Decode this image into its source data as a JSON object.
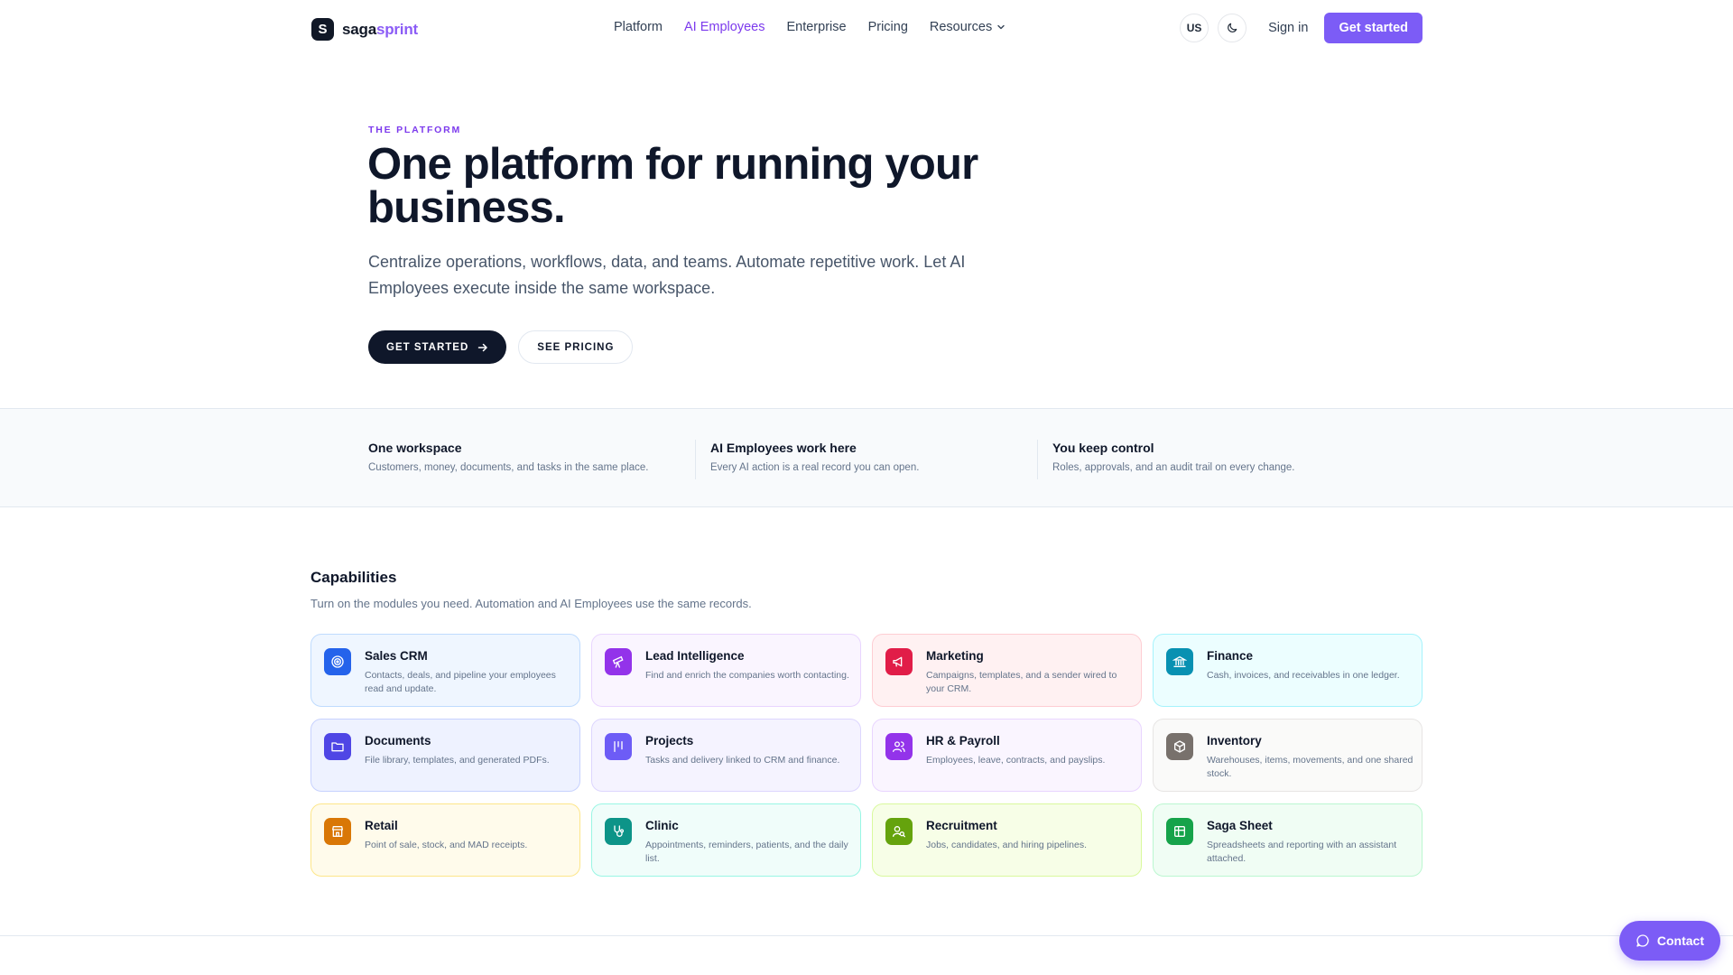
{
  "nav": {
    "logo_mark": "S",
    "logo_left": "saga",
    "logo_right": "sprint",
    "links": [
      "Platform",
      "AI Employees",
      "Enterprise",
      "Pricing",
      "Resources"
    ],
    "locale": "US",
    "sign_in": "Sign in",
    "get_started": "Get started"
  },
  "hero": {
    "eyebrow": "THE PLATFORM",
    "title": "One platform for running your business.",
    "subtitle": "Centralize operations, workflows, data, and teams. Automate repetitive work. Let AI Employees execute inside the same workspace.",
    "primary_button": "GET STARTED",
    "secondary_button": "SEE PRICING"
  },
  "features": [
    {
      "title": "One workspace",
      "desc": "Customers, money, documents, and tasks in the same place."
    },
    {
      "title": "AI Employees work here",
      "desc": "Every AI action is a real record you can open."
    },
    {
      "title": "You keep control",
      "desc": "Roles, approvals, and an audit trail on every change."
    }
  ],
  "capabilities": {
    "title": "Capabilities",
    "subtitle": "Turn on the modules you need. Automation and AI Employees use the same records.",
    "cards": [
      {
        "title": "Sales CRM",
        "desc": "Contacts, deals, and pipeline your employees read and update.",
        "icon": "target-icon",
        "color": "#2563eb",
        "bg": "#eff6ff",
        "border": "#bfdbfe"
      },
      {
        "title": "Lead Intelligence",
        "desc": "Find and enrich the companies worth contacting.",
        "icon": "telescope-icon",
        "color": "#9333ea",
        "bg": "#faf5ff",
        "border": "#e9d5ff"
      },
      {
        "title": "Marketing",
        "desc": "Campaigns, templates, and a sender wired to your CRM.",
        "icon": "megaphone-icon",
        "color": "#e11d48",
        "bg": "#fff1f2",
        "border": "#fecdd3"
      },
      {
        "title": "Finance",
        "desc": "Cash, invoices, and receivables in one ledger.",
        "icon": "bank-icon",
        "color": "#0891b2",
        "bg": "#ecfeff",
        "border": "#a5f3fc"
      },
      {
        "title": "Documents",
        "desc": "File library, templates, and generated PDFs.",
        "icon": "folder-icon",
        "color": "#4f46e5",
        "bg": "#eef2ff",
        "border": "#c7d2fe"
      },
      {
        "title": "Projects",
        "desc": "Tasks and delivery linked to CRM and finance.",
        "icon": "kanban-icon",
        "color": "#6d5cf6",
        "bg": "#f5f3ff",
        "border": "#ddd6fe"
      },
      {
        "title": "HR & Payroll",
        "desc": "Employees, leave, contracts, and payslips.",
        "icon": "users-icon",
        "color": "#9333ea",
        "bg": "#faf5ff",
        "border": "#e9d5ff"
      },
      {
        "title": "Inventory",
        "desc": "Warehouses, items, movements, and one shared stock.",
        "icon": "box-icon",
        "color": "#78716c",
        "bg": "#fafaf9",
        "border": "#e7e5e4"
      },
      {
        "title": "Retail",
        "desc": "Point of sale, stock, and MAD receipts.",
        "icon": "store-icon",
        "color": "#d97706",
        "bg": "#fffbeb",
        "border": "#fde68a"
      },
      {
        "title": "Clinic",
        "desc": "Appointments, reminders, patients, and the daily list.",
        "icon": "stethoscope-icon",
        "color": "#0d9488",
        "bg": "#f0fdfa",
        "border": "#99f6e4"
      },
      {
        "title": "Recruitment",
        "desc": "Jobs, candidates, and hiring pipelines.",
        "icon": "user-search-icon",
        "color": "#65a30d",
        "bg": "#f7fee7",
        "border": "#d9f99d"
      },
      {
        "title": "Saga Sheet",
        "desc": "Spreadsheets and reporting with an assistant attached.",
        "icon": "sheet-icon",
        "color": "#16a34a",
        "bg": "#f0fdf4",
        "border": "#bbf7d0"
      }
    ]
  },
  "contact_button": "Contact"
}
